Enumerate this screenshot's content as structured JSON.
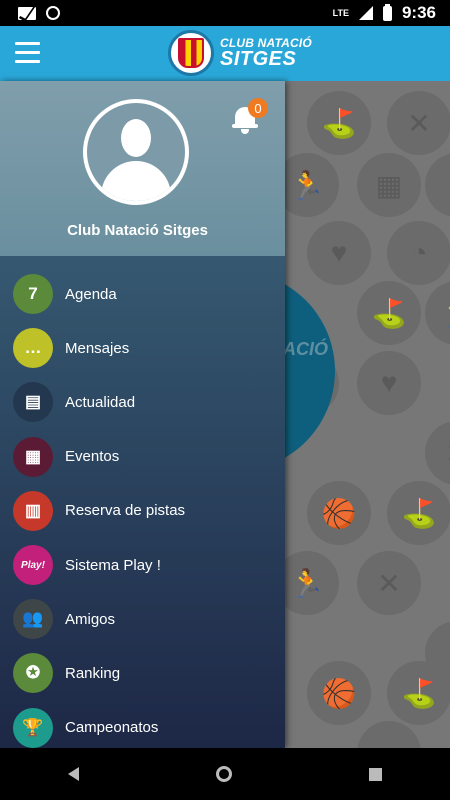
{
  "status_bar": {
    "time": "9:36",
    "network": "LTE",
    "icons": [
      "gmail-icon",
      "circle-icon",
      "signal-icon",
      "battery-icon"
    ]
  },
  "header": {
    "brand_line1": "CLUB NATACIÓ",
    "brand_line2": "SITGES",
    "bar_color": "#2aa7d9"
  },
  "drawer": {
    "profile_name": "Club Natació Sitges",
    "notification_count": "0",
    "items": [
      {
        "label": "Agenda",
        "icon": "calendar-icon",
        "color": "#5a8a3a",
        "glyph": "7"
      },
      {
        "label": "Mensajes",
        "icon": "chat-icon",
        "color": "#bfc128",
        "glyph": "…"
      },
      {
        "label": "Actualidad",
        "icon": "news-icon",
        "color": "#23384e",
        "glyph": "▤"
      },
      {
        "label": "Eventos",
        "icon": "calendar-grid-icon",
        "color": "#5b1b35",
        "glyph": "▦"
      },
      {
        "label": "Reserva de pistas",
        "icon": "court-icon",
        "color": "#c6392a",
        "glyph": "▥"
      },
      {
        "label": "Sistema Play !",
        "icon": "play-icon",
        "color": "#c2207a",
        "glyph": "Play!"
      },
      {
        "label": "Amigos",
        "icon": "friends-icon",
        "color": "#3f4648",
        "glyph": "👥"
      },
      {
        "label": "Ranking",
        "icon": "medal-icon",
        "color": "#5a8a3a",
        "glyph": "✪"
      },
      {
        "label": "Campeonatos",
        "icon": "trophy-icon",
        "color": "#1d9c8e",
        "glyph": "🏆"
      }
    ]
  },
  "background": {
    "tiles": [
      "⛳",
      "✕",
      "🏃",
      "▦",
      "◐",
      "♥",
      "◔",
      "⛳",
      "🏃",
      "▦",
      "♥",
      "✕",
      "🏀",
      "⛳",
      "🏃",
      "✕",
      "♥",
      "🏀",
      "⛳",
      "◐"
    ],
    "disc_text": "ACIÓ"
  }
}
